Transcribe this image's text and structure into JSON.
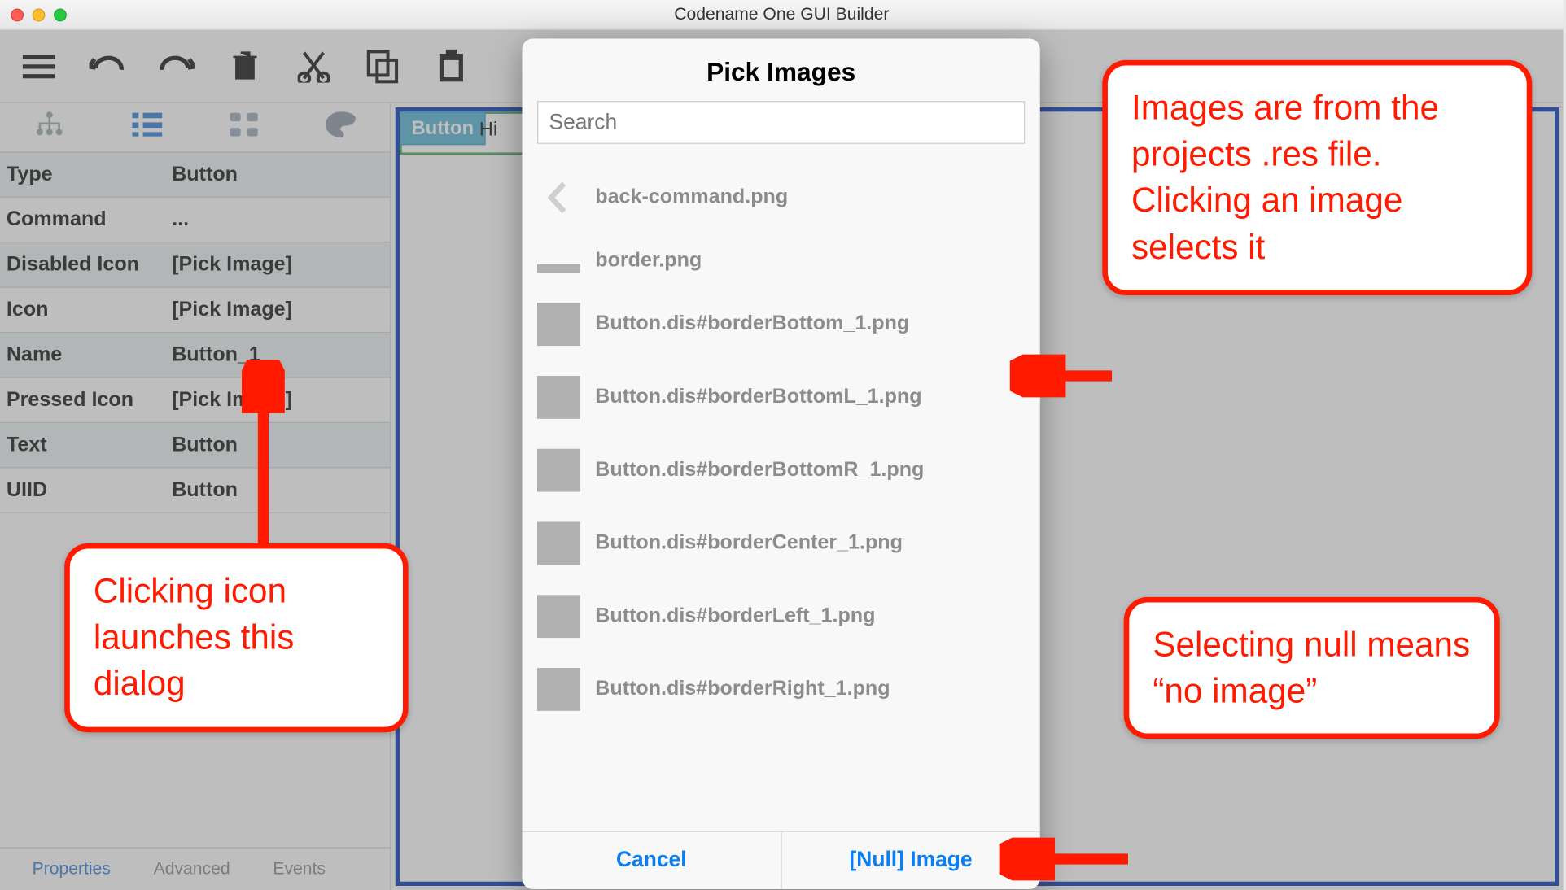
{
  "window": {
    "title": "Codename One GUI Builder"
  },
  "toolbar": {
    "menu": "menu",
    "undo": "undo",
    "redo": "redo",
    "delete": "delete",
    "cut": "cut",
    "copy": "copy",
    "paste": "paste"
  },
  "canvas": {
    "button_label": "Button",
    "hi_label": "Hi"
  },
  "properties": {
    "tabs": {
      "properties": "Properties",
      "advanced": "Advanced",
      "events": "Events"
    },
    "rows": [
      {
        "label": "Type",
        "value": "Button"
      },
      {
        "label": "Command",
        "value": "..."
      },
      {
        "label": "Disabled Icon",
        "value": "[Pick Image]"
      },
      {
        "label": "Icon",
        "value": "[Pick Image]"
      },
      {
        "label": "Name",
        "value": "Button_1"
      },
      {
        "label": "Pressed Icon",
        "value": "[Pick Image]"
      },
      {
        "label": "Text",
        "value": "Button"
      },
      {
        "label": "UIID",
        "value": "Button"
      }
    ]
  },
  "dialog": {
    "title": "Pick Images",
    "search_placeholder": "Search",
    "items": [
      {
        "name": "back-command.png",
        "kind": "back"
      },
      {
        "name": "border.png",
        "kind": "thin"
      },
      {
        "name": "Button.dis#borderBottom_1.png",
        "kind": "square"
      },
      {
        "name": "Button.dis#borderBottomL_1.png",
        "kind": "square"
      },
      {
        "name": "Button.dis#borderBottomR_1.png",
        "kind": "square"
      },
      {
        "name": "Button.dis#borderCenter_1.png",
        "kind": "square"
      },
      {
        "name": "Button.dis#borderLeft_1.png",
        "kind": "square"
      },
      {
        "name": "Button.dis#borderRight_1.png",
        "kind": "square"
      }
    ],
    "cancel": "Cancel",
    "null_image": "[Null] Image"
  },
  "callouts": {
    "left": "Clicking icon launches this dialog",
    "topright": "Images are from the projects .res file. Clicking an image selects it",
    "bottomright": "Selecting null means “no image”"
  }
}
